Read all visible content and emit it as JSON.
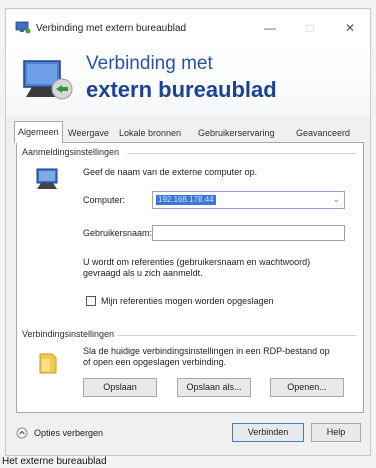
{
  "window": {
    "title": "Verbinding met extern bureaublad",
    "controls": {
      "minimize": "—",
      "maximize": "□",
      "close": "✕"
    }
  },
  "banner": {
    "line1": "Verbinding met",
    "line2": "extern bureaublad"
  },
  "tabs": [
    {
      "label": "Algemeen",
      "active": true
    },
    {
      "label": "Weergave",
      "active": false
    },
    {
      "label": "Lokale bronnen",
      "active": false
    },
    {
      "label": "Gebruikerservaring",
      "active": false
    },
    {
      "label": "Geavanceerd",
      "active": false
    }
  ],
  "logon": {
    "group_title": "Aanmeldingsinstellingen",
    "instruction": "Geef de naam van de externe computer op.",
    "computer_label": "Computer:",
    "computer_value": "192.168.178.44",
    "username_label": "Gebruikersnaam:",
    "username_value": "",
    "credentials_note_line1": "U wordt om referenties (gebruikersnaam en wachtwoord)",
    "credentials_note_line2": "gevraagd als u zich aanmeldt.",
    "save_credentials_label": "Mijn referenties mogen worden opgeslagen",
    "save_credentials_checked": false
  },
  "connection": {
    "group_title": "Verbindingsinstellingen",
    "description_line1": "Sla de huidige verbindingsinstellingen in een RDP-bestand op",
    "description_line2": "of open een opgeslagen verbinding.",
    "save_button": "Opslaan",
    "save_as_button": "Opslaan als...",
    "open_button": "Openen..."
  },
  "footer": {
    "options_label": "Opties verbergen",
    "connect_button": "Verbinden",
    "help_button": "Help"
  },
  "taskbar": {
    "label": "Het externe bureaublad"
  },
  "colors": {
    "accent": "#2a53a6",
    "selection": "#3a78d8"
  }
}
